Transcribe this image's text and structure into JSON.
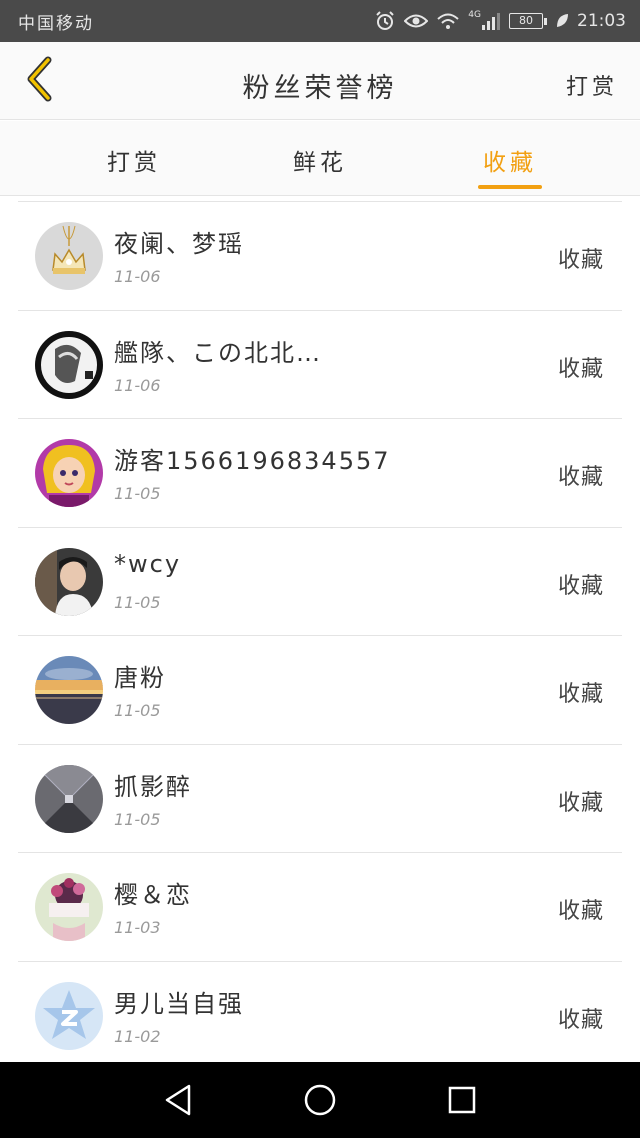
{
  "status_bar": {
    "carrier": "中国移动",
    "network": "4G",
    "battery": "80",
    "time": "21:03"
  },
  "header": {
    "title": "粉丝荣誉榜",
    "action_label": "打赏"
  },
  "tabs": [
    {
      "label": "打赏",
      "active": false
    },
    {
      "label": "鲜花",
      "active": false
    },
    {
      "label": "收藏",
      "active": true
    }
  ],
  "accent_color": "#f2a012",
  "list": [
    {
      "name": "夜阑、梦瑶",
      "date": "11-06",
      "action": "收藏",
      "avatar": "crown-pendant-avatar"
    },
    {
      "name": "艦隊、この北北…",
      "date": "11-06",
      "action": "收藏",
      "avatar": "dark-figure-avatar"
    },
    {
      "name": "游客1566196834557",
      "date": "11-05",
      "action": "收藏",
      "avatar": "cartoon-girl-avatar"
    },
    {
      "name": "*wcy",
      "date": "11-05",
      "action": "收藏",
      "avatar": "boy-portrait-avatar"
    },
    {
      "name": "唐粉",
      "date": "11-05",
      "action": "收藏",
      "avatar": "sunset-landscape-avatar"
    },
    {
      "name": "抓影醉",
      "date": "11-05",
      "action": "收藏",
      "avatar": "tunnel-avatar"
    },
    {
      "name": "樱＆恋",
      "date": "11-03",
      "action": "收藏",
      "avatar": "flowers-avatar"
    },
    {
      "name": "男儿当自强",
      "date": "11-02",
      "action": "收藏",
      "avatar": "default-star-avatar"
    }
  ]
}
